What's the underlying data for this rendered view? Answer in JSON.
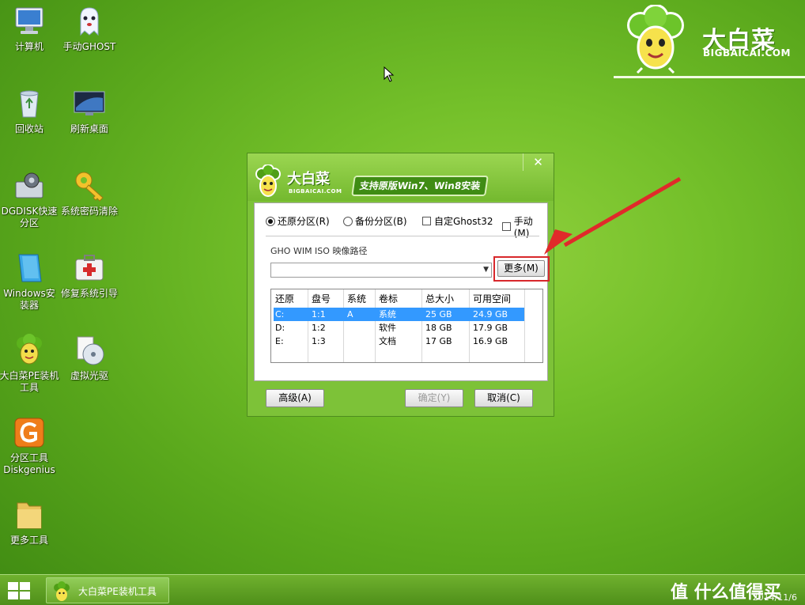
{
  "desktop_icons": [
    {
      "label": "计算机",
      "icon": "computer-icon"
    },
    {
      "label": "手动GHOST",
      "icon": "ghost-icon"
    },
    {
      "label": "回收站",
      "icon": "recycle-bin-icon"
    },
    {
      "label": "刷新桌面",
      "icon": "monitor-refresh-icon"
    },
    {
      "label": "DGDISK快速分区",
      "icon": "disk-gear-icon"
    },
    {
      "label": "系统密码清除",
      "icon": "key-icon"
    },
    {
      "label": "Windows安装器",
      "icon": "windows-installer-icon"
    },
    {
      "label": "修复系统引导",
      "icon": "first-aid-kit-icon"
    },
    {
      "label": "大白菜PE装机工具",
      "icon": "dabaicai-mascot-icon"
    },
    {
      "label": "虚拟光驱",
      "icon": "virtual-drive-icon"
    },
    {
      "label": "分区工具Diskgenius",
      "icon": "diskgenius-icon"
    },
    {
      "label": "更多工具",
      "icon": "folder-icon"
    }
  ],
  "brand": {
    "name": "大白菜",
    "url": "BIGBAICAI.COM"
  },
  "dialog": {
    "title_name": "大白菜",
    "title_url": "BIGBAICAI.COM",
    "slogan": "支持原版Win7、Win8安装",
    "close": "✕",
    "options": {
      "restore": "还原分区(R)",
      "backup": "备份分区(B)",
      "custom_ghost": "自定Ghost32",
      "manual": "手动(M)"
    },
    "selected_option": "restore",
    "path_label": "GHO WIM ISO 映像路径",
    "path_value": "",
    "more_button": "更多(M)",
    "table": {
      "headers": [
        "还原",
        "盘号",
        "系统",
        "卷标",
        "总大小",
        "可用空间"
      ],
      "rows": [
        [
          "C:",
          "1:1",
          "A",
          "系统",
          "25 GB",
          "24.9 GB"
        ],
        [
          "D:",
          "1:2",
          "",
          "软件",
          "18 GB",
          "17.9 GB"
        ],
        [
          "E:",
          "1:3",
          "",
          "文档",
          "17 GB",
          "16.9 GB"
        ]
      ],
      "selected_row": 0
    },
    "buttons": {
      "advanced": "高级(A)",
      "ok": "确定(Y)",
      "cancel": "取消(C)"
    }
  },
  "taskbar": {
    "start_icon": "windows-start-icon",
    "task_label": "大白菜PE装机工具",
    "watermark": "值 什么值得买",
    "date": "2014/11/6"
  },
  "colors": {
    "desktop_green": "#74c02a",
    "dialog_green": "#7dc238",
    "highlight_red": "#d8282c",
    "selection_blue": "#3399ff"
  }
}
